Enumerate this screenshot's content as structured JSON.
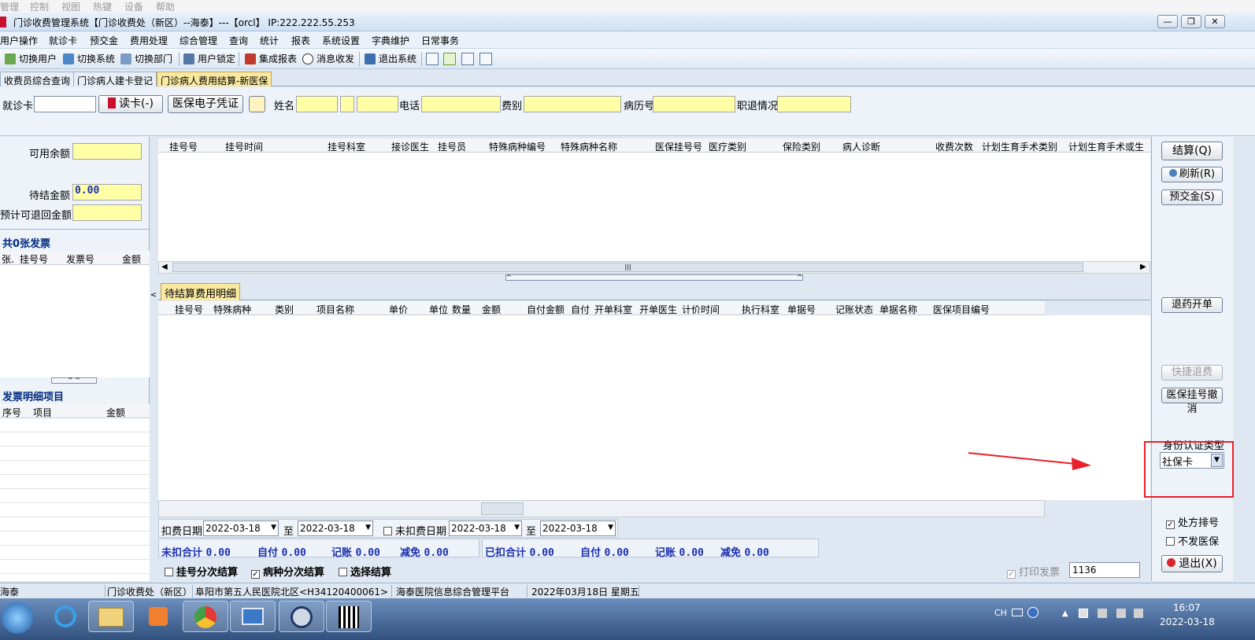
{
  "top_menu": [
    "管理",
    "控制",
    "视图",
    "热键",
    "设备",
    "帮助"
  ],
  "window": {
    "title": "门诊收费管理系统【门诊收费处（新区）--海泰】---【orcl】 IP:222.222.55.253"
  },
  "menubar": [
    "用户操作",
    "就诊卡",
    "预交金",
    "费用处理",
    "综合管理",
    "查询",
    "统计",
    "报表",
    "系统设置",
    "字典维护",
    "日常事务"
  ],
  "toolbar": [
    "切换用户",
    "切换系统",
    "切换部门",
    "用户锁定",
    "集成报表",
    "消息收发",
    "退出系统"
  ],
  "tabs": [
    "收费员综合查询",
    "门诊病人建卡登记",
    "门诊病人费用结算-新医保"
  ],
  "patient": {
    "card_label": "就诊卡",
    "read_card_btn": "读卡(-)",
    "voucher_btn": "医保电子凭证",
    "name_label": "姓名",
    "phone_label": "电话",
    "fee_type_label": "费别",
    "record_no_label": "病历号",
    "retire_label": "职退情况"
  },
  "left": {
    "available_label": "可用余额",
    "pending_label": "待结金额",
    "pending_value": "0.00",
    "refund_label": "预计可退回金额",
    "invoice_title": "共0张发票",
    "invoice_cols": [
      "张.",
      "挂号号",
      "发票号",
      "金额"
    ],
    "detail_title": "发票明细项目",
    "detail_cols": [
      "序号",
      "项目",
      "金额"
    ]
  },
  "reg_table_cols": [
    "挂号号",
    "挂号时间",
    "挂号科室",
    "接诊医生",
    "挂号员",
    "特殊病种编号",
    "特殊病种名称",
    "医保挂号号",
    "医疗类别",
    "保险类别",
    "病人诊断",
    "收费次数",
    "计划生育手术类别",
    "计划生育手术或生"
  ],
  "detail_tab": "待结算费用明细",
  "fee_table_cols": [
    "挂号号",
    "特殊病种",
    "类别",
    "项目名称",
    "单价",
    "单位",
    "数量",
    "金额",
    "自付金额",
    "自付",
    "开单科室",
    "开单医生",
    "计价时间",
    "执行科室",
    "单据号",
    "记账状态",
    "单据名称",
    "医保项目编号"
  ],
  "dates": {
    "deduct_label": "扣费日期",
    "from": "2022-03-18",
    "to_label": "至",
    "to": "2022-03-18",
    "undeducted_label": "未扣费日期",
    "u_from": "2022-03-18",
    "u_to": "2022-03-18"
  },
  "totals": {
    "undeducted_label": "未扣合计",
    "undeducted": "0.00",
    "self_label": "自付",
    "self": "0.00",
    "credit_label": "记账",
    "credit": "0.00",
    "relief_label": "减免",
    "relief": "0.00",
    "deducted_label": "已扣合计",
    "deducted": "0.00",
    "self2": "0.00",
    "credit2": "0.00",
    "relief2": "0.00"
  },
  "options": {
    "reg_split": "挂号分次结算",
    "disease_split": "病种分次结算",
    "select_settle": "选择结算",
    "print_invoice": "打印发票",
    "invoice_no": "1136"
  },
  "right": {
    "settle": "结算(Q)",
    "refresh": "刷新(R)",
    "prepay": "预交金(S)",
    "return_drug": "退药开单",
    "quick_refund": "快捷退费",
    "cancel_reg": "医保挂号撤消",
    "id_type_label": "身份认证类型",
    "id_type_value": "社保卡",
    "rx_sort": "处方排号",
    "no_insurance": "不发医保",
    "exit": "退出(X)"
  },
  "statusbar": [
    "海泰",
    "门诊收费处（新区）",
    "阜阳市第五人民医院北区<H34120400061>",
    "海泰医院信息综合管理平台",
    "2022年03月18日 星期五"
  ],
  "taskbar": {
    "lang": "CH",
    "time": "16:07",
    "date": "2022-03-18"
  },
  "colors": {
    "field_yellow": "#ffffa6",
    "accent_blue": "#1a2fb0",
    "highlight_red": "#e8202a"
  }
}
